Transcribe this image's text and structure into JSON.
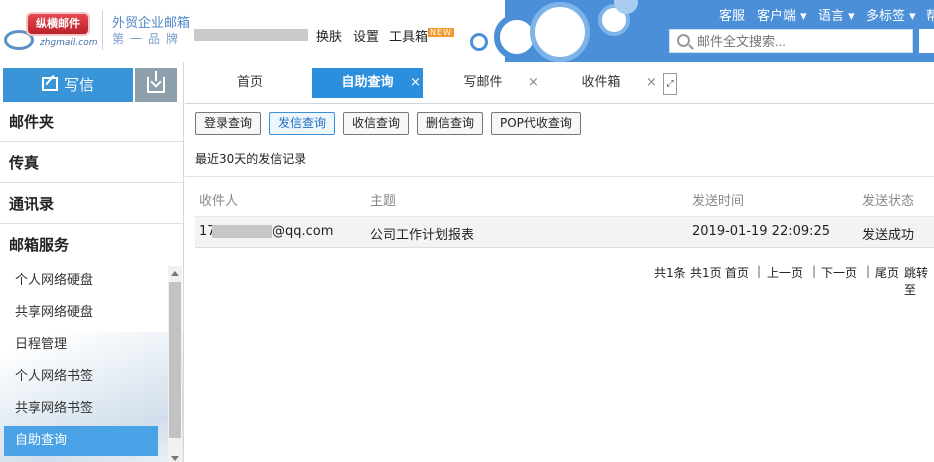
{
  "logo": {
    "badge_text": "纵横邮件",
    "domain": "zhgmail.com",
    "slogan_line1": "外贸企业邮箱",
    "slogan_line2": "第一品牌"
  },
  "toolbar": {
    "skin_label": "换肤",
    "settings_label": "设置",
    "tools_label": "工具箱",
    "tools_badge": "NEW"
  },
  "topnav": {
    "service": "客服",
    "client": "客户端 ▾",
    "language": "语言 ▾",
    "multitab": "多标签 ▾",
    "help": "帮"
  },
  "search": {
    "placeholder": "邮件全文搜索..."
  },
  "sidebar": {
    "compose_label": "写信",
    "sections": [
      "邮件夹",
      "传真",
      "通讯录",
      "邮箱服务"
    ],
    "service_items": [
      "个人网络硬盘",
      "共享网络硬盘",
      "日程管理",
      "个人网络书签",
      "共享网络书签",
      "自助查询"
    ],
    "active_item": "自助查询"
  },
  "tabs": [
    {
      "label": "首页",
      "closable": false
    },
    {
      "label": "自助查询",
      "closable": true,
      "active": true
    },
    {
      "label": "写邮件",
      "closable": true
    },
    {
      "label": "收件箱",
      "closable": true
    }
  ],
  "tab_close_glyph": "×",
  "tab_expand_glyph": "⤢",
  "query": {
    "buttons": [
      "登录查询",
      "发信查询",
      "收信查询",
      "删信查询",
      "POP代收查询"
    ],
    "active_button": "发信查询",
    "subtitle": "最近30天的发信记录"
  },
  "table": {
    "headers": [
      "收件人",
      "主题",
      "发送时间",
      "发送状态"
    ],
    "rows": [
      {
        "recipient_prefix": "17",
        "recipient_suffix": "@qq.com",
        "subject": "公司工作计划报表",
        "time": "2019-01-19 22:09:25",
        "status": "发送成功"
      }
    ]
  },
  "pager": {
    "total": "共1条",
    "pages": "共1页",
    "first": "首页",
    "prev": "上一页",
    "next": "下一页",
    "last": "尾页",
    "jump": "跳转至",
    "sep": "|"
  },
  "colors": {
    "brand_blue": "#2c8fde",
    "header_blue": "#4a8fd8",
    "sidebar_active": "#4aa3e6"
  }
}
